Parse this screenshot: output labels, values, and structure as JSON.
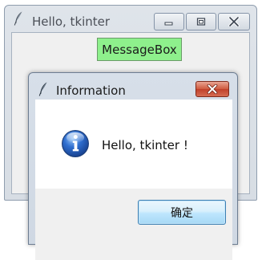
{
  "main_window": {
    "title": "Hello, tkinter",
    "button_label": "MessageBox",
    "button_color": "#8ef08c",
    "icons": [
      "feather-icon",
      "minimize-icon",
      "maximize-icon",
      "close-icon"
    ]
  },
  "dialog": {
    "title": "Information",
    "message": "Hello, tkinter !",
    "ok_label": "确定",
    "icons": [
      "feather-icon",
      "info-icon",
      "close-icon"
    ]
  }
}
